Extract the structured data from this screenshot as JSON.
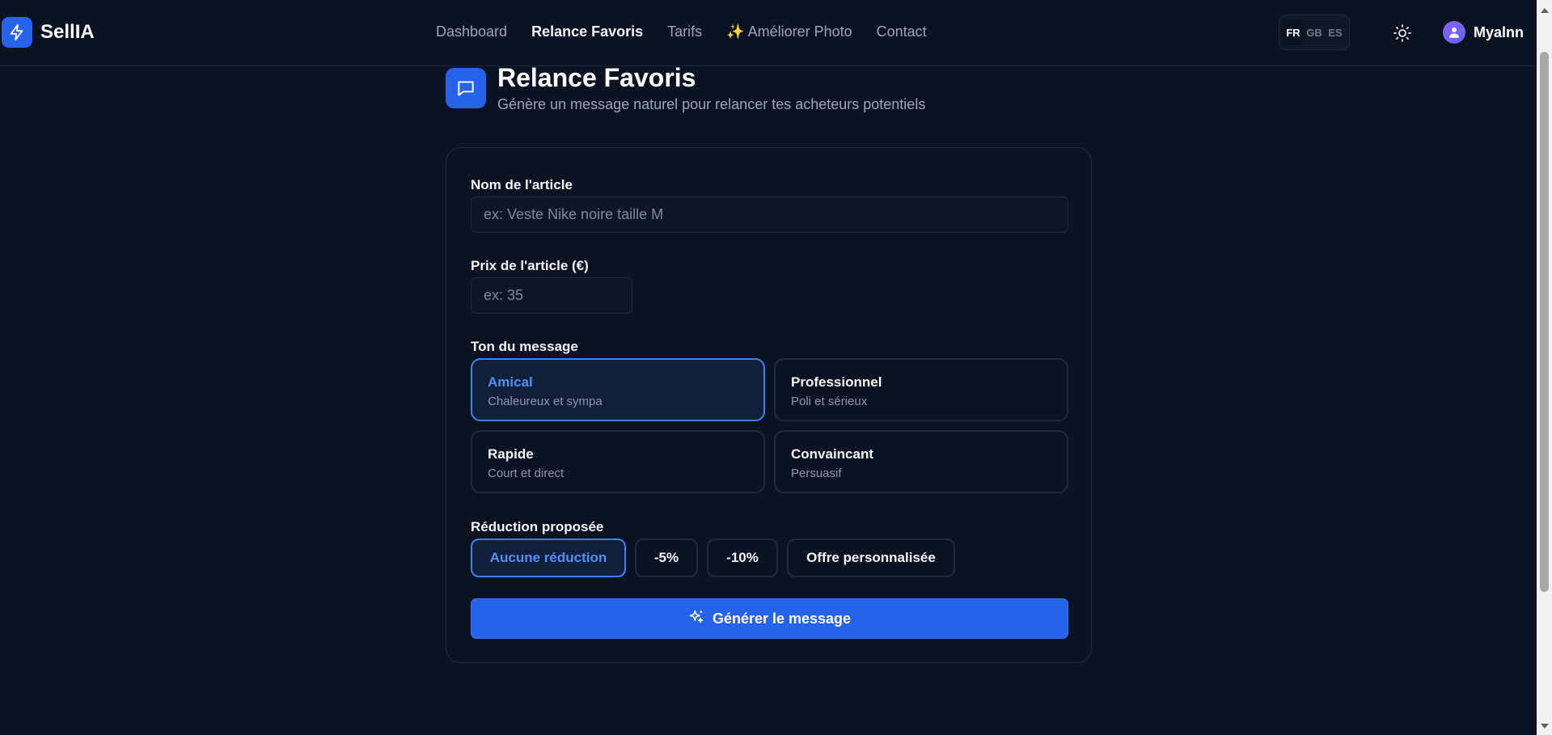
{
  "brand": {
    "name": "SellIA"
  },
  "nav": {
    "items": [
      {
        "label": "Dashboard",
        "active": false
      },
      {
        "label": "Relance Favoris",
        "active": true
      },
      {
        "label": "Tarifs",
        "active": false
      },
      {
        "label": "✨ Améliorer Photo",
        "active": false
      },
      {
        "label": "Contact",
        "active": false
      }
    ]
  },
  "languages": {
    "items": [
      "FR",
      "GB",
      "ES"
    ],
    "selected": "FR"
  },
  "user": {
    "name": "Myalnn"
  },
  "page": {
    "title": "Relance Favoris",
    "subtitle": "Génère un message naturel pour relancer tes acheteurs potentiels"
  },
  "form": {
    "article_name": {
      "label": "Nom de l'article",
      "placeholder": "ex: Veste Nike noire taille M",
      "value": ""
    },
    "article_price": {
      "label": "Prix de l'article (€)",
      "placeholder": "ex: 35",
      "value": ""
    },
    "tone": {
      "label": "Ton du message",
      "selected": "Amical",
      "options": [
        {
          "title": "Amical",
          "desc": "Chaleureux et sympa"
        },
        {
          "title": "Professionnel",
          "desc": "Poli et sérieux"
        },
        {
          "title": "Rapide",
          "desc": "Court et direct"
        },
        {
          "title": "Convaincant",
          "desc": "Persuasif"
        }
      ]
    },
    "discount": {
      "label": "Réduction proposée",
      "selected": "Aucune réduction",
      "options": [
        "Aucune réduction",
        "-5%",
        "-10%",
        "Offre personnalisée"
      ]
    },
    "generate_label": "Générer le message"
  },
  "colors": {
    "background": "#0b1322",
    "accent": "#2563eb",
    "accent_text": "#4f8ff7",
    "border": "#1f2a3d"
  }
}
